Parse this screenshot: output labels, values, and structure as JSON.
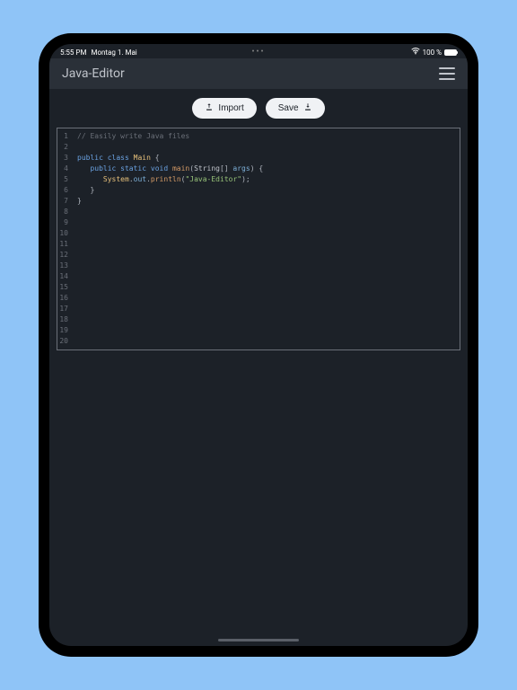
{
  "status": {
    "time": "5:55 PM",
    "date": "Montag 1. Mai",
    "battery_pct": "100 %",
    "center_dots": "•••"
  },
  "header": {
    "title": "Java-Editor"
  },
  "toolbar": {
    "import_label": "Import",
    "save_label": "Save"
  },
  "editor": {
    "line_count": 20,
    "lines": [
      {
        "tokens": [
          {
            "t": "// Easily write Java files",
            "c": "tok-comment"
          }
        ]
      },
      {
        "tokens": []
      },
      {
        "tokens": [
          {
            "t": "public class ",
            "c": "tok-keyword"
          },
          {
            "t": "Main",
            "c": "tok-class"
          },
          {
            "t": " {",
            "c": "tok-punct"
          }
        ]
      },
      {
        "tokens": [
          {
            "t": "   ",
            "c": ""
          },
          {
            "t": "public static void ",
            "c": "tok-keyword"
          },
          {
            "t": "main",
            "c": "tok-method"
          },
          {
            "t": "(",
            "c": "tok-punct"
          },
          {
            "t": "String",
            "c": "tok-type"
          },
          {
            "t": "[] ",
            "c": "tok-punct"
          },
          {
            "t": "args",
            "c": "tok-var"
          },
          {
            "t": ") {",
            "c": "tok-punct"
          }
        ]
      },
      {
        "tokens": [
          {
            "t": "      ",
            "c": ""
          },
          {
            "t": "System",
            "c": "tok-sys"
          },
          {
            "t": ".",
            "c": "tok-punct"
          },
          {
            "t": "out",
            "c": "tok-var"
          },
          {
            "t": ".",
            "c": "tok-punct"
          },
          {
            "t": "println",
            "c": "tok-method"
          },
          {
            "t": "(",
            "c": "tok-punct"
          },
          {
            "t": "\"Java-Editor\"",
            "c": "tok-string"
          },
          {
            "t": ");",
            "c": "tok-punct"
          }
        ]
      },
      {
        "tokens": [
          {
            "t": "   }",
            "c": "tok-punct"
          }
        ]
      },
      {
        "tokens": [
          {
            "t": "}",
            "c": "tok-punct"
          }
        ]
      }
    ]
  }
}
